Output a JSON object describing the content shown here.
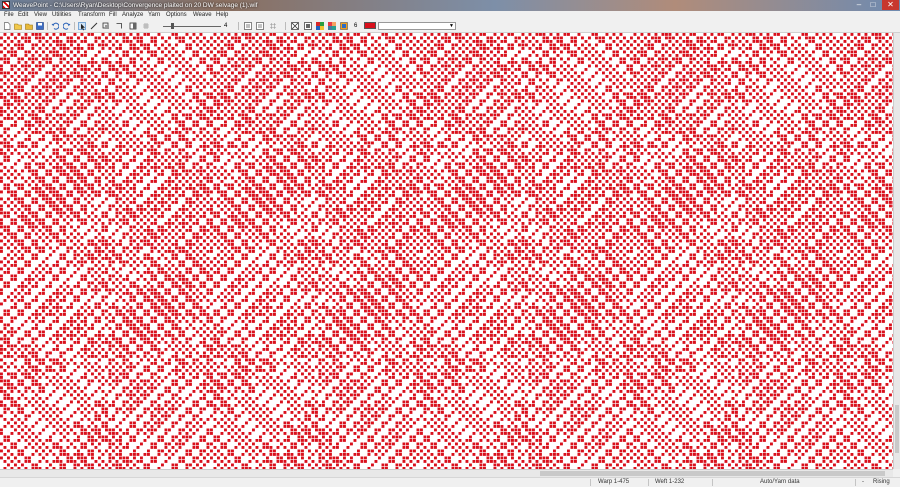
{
  "window": {
    "title": "WeavePoint - C:\\Users\\Ryan\\Desktop\\Convergence plaited on 20 DW selvage (1).wif",
    "min_glyph": "–",
    "max_glyph": "□",
    "close_glyph": "✕"
  },
  "menu": {
    "items": [
      "File",
      "Edit",
      "View",
      "Utilities",
      "Transform",
      "Fill",
      "Analyze",
      "Yarn",
      "Options",
      "Weave",
      "Help"
    ]
  },
  "toolbar": {
    "zoom_value": "4",
    "color_number": "6",
    "active_color": "#d9101c"
  },
  "drawdown": {
    "warp_color": "#d9101c",
    "weft_color": "#ffffff",
    "cell_size": 3.5
  },
  "status": {
    "warp": "Warp 1-475",
    "weft": "Weft 1-232",
    "data_mode": "Auto/Yarn data",
    "dash": "-",
    "shed": "Rising"
  }
}
